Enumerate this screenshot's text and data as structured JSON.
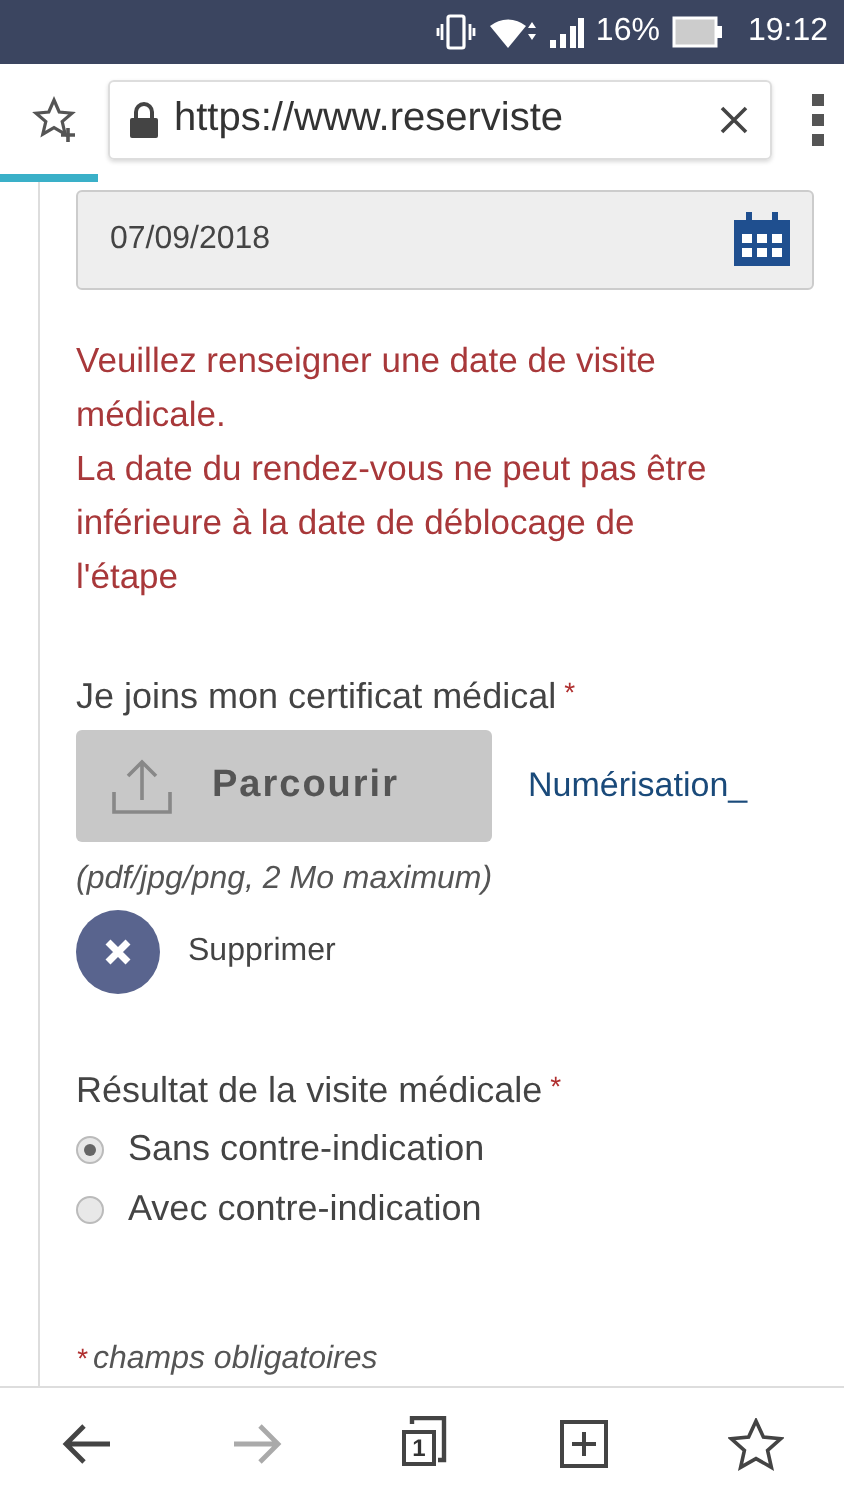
{
  "status_bar": {
    "battery": "16%",
    "time": "19:12"
  },
  "browser": {
    "url": "https://www.reserviste",
    "loading": {
      "level": 0.115
    }
  },
  "form": {
    "date_field": {
      "value": "07/09/2018"
    },
    "errors": [
      "Veuillez renseigner une date de visite médicale.",
      "La date du rendez-vous ne peut pas être inférieure à la date de déblocage de l'étape"
    ],
    "certificate": {
      "label": "Je joins mon certificat médical",
      "required_mark": "*",
      "browse_button": "Parcourir",
      "file_name": "Numérisation_",
      "hint": "(pdf/jpg/png, 2 Mo maximum)",
      "remove": "Supprimer"
    },
    "result": {
      "label": "Résultat de la visite médicale",
      "required_mark": "*",
      "options": [
        {
          "label": "Sans contre-indication",
          "selected": true
        },
        {
          "label": "Avec contre-indication",
          "selected": false
        }
      ]
    },
    "footnote": {
      "required_mark": "*",
      "text": "champs obligatoires"
    }
  },
  "bottom_nav": {
    "back_disabled": false,
    "forward_disabled": true,
    "tab_count": "1"
  }
}
